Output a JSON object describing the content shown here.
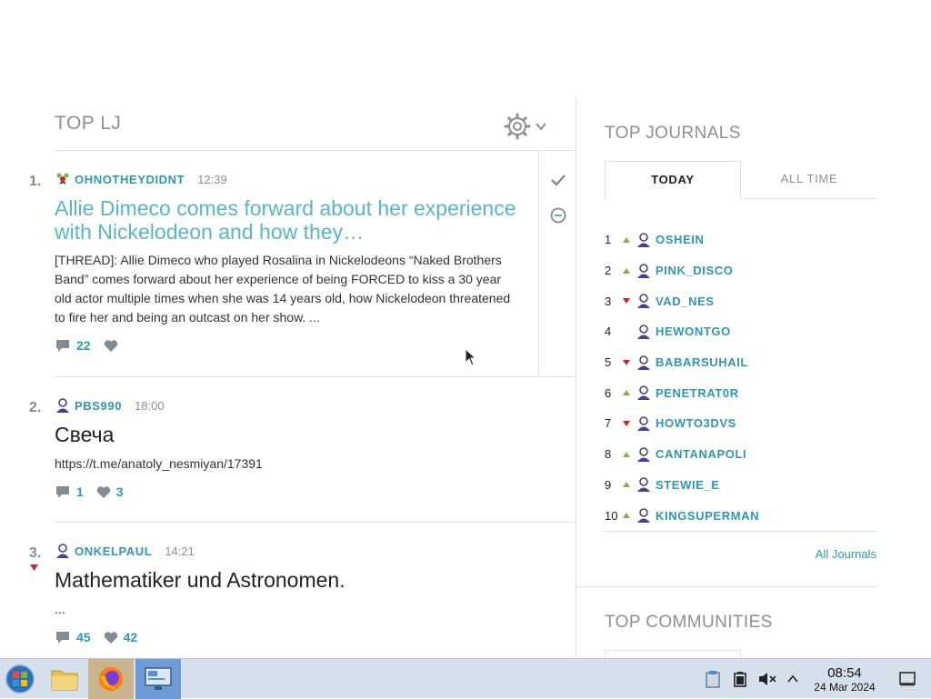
{
  "top_lj": {
    "title": "TOP LJ"
  },
  "posts": [
    {
      "rank": "1.",
      "author": "OHNOTHEYDIDNT",
      "time": "12:39",
      "title": "Allie Dimeco comes forward about her experience with Nickelodeon and how they…",
      "body": "[THREAD]: Allie Dimeco who played Rosalina in Nickelodeons “Naked Brothers Band” comes forward about her experience of being FORCED to kiss a 30 year old actor multiple times when she was 14 years old, how Nickelodeon threatened to fire her and being an outcast on her show. ...",
      "comments": "22",
      "likes": ""
    },
    {
      "rank": "2.",
      "author": "PBS990",
      "time": "18:00",
      "title": "Свеча",
      "body": "https://t.me/anatoly_nesmiyan/17391",
      "comments": "1",
      "likes": "3"
    },
    {
      "rank": "3.",
      "author": "ONKELPAUL",
      "time": "14:21",
      "title": "Mathematiker und Astronomen.",
      "body": "...",
      "comments": "45",
      "likes": "42"
    }
  ],
  "top_journals": {
    "title": "TOP JOURNALS",
    "tabs": [
      "TODAY",
      "ALL TIME"
    ],
    "active_tab": "TODAY",
    "items": [
      {
        "rank": "1",
        "trend": "up",
        "name": "OSHEIN"
      },
      {
        "rank": "2",
        "trend": "up",
        "name": "PINK_DISCO"
      },
      {
        "rank": "3",
        "trend": "down",
        "name": "VAD_NES"
      },
      {
        "rank": "4",
        "trend": "none",
        "name": "HEWONTGO"
      },
      {
        "rank": "5",
        "trend": "down",
        "name": "BABARSUHAIL"
      },
      {
        "rank": "6",
        "trend": "up",
        "name": "PENETRAT0R"
      },
      {
        "rank": "7",
        "trend": "down",
        "name": "HOWTO3DVS"
      },
      {
        "rank": "8",
        "trend": "up",
        "name": "CANTANAPOLI"
      },
      {
        "rank": "9",
        "trend": "up",
        "name": "STEWIE_E"
      },
      {
        "rank": "10",
        "trend": "up",
        "name": "KINGSUPERMAN"
      }
    ],
    "all_link": "All Journals"
  },
  "top_communities": {
    "title": "TOP COMMUNITIES"
  },
  "taskbar": {
    "time": "08:54",
    "date": "24 Mar 2024"
  },
  "colors": {
    "link": "#2f96b4",
    "title_link": "#5ab4cc",
    "trend_up": "#7cb342",
    "trend_down": "#c62828"
  }
}
